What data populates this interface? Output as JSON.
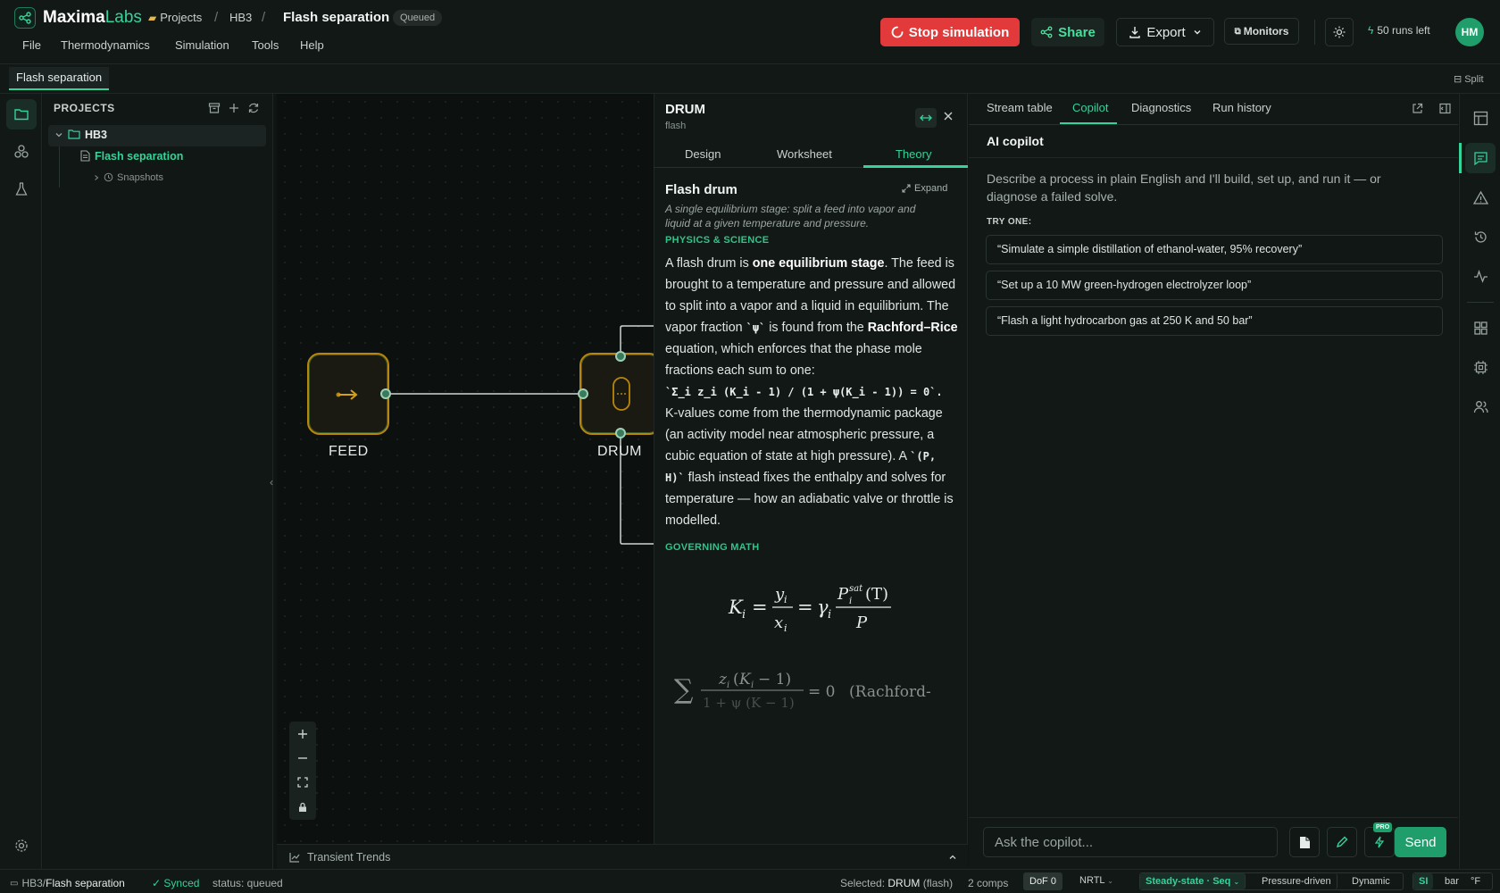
{
  "app": {
    "brand_main": "Maxima",
    "brand_accent": "Labs"
  },
  "breadcrumb": {
    "projects": "Projects",
    "project": "HB3",
    "title": "Flash separation",
    "status": "Queued"
  },
  "menus": [
    "File",
    "Thermodynamics",
    "Simulation",
    "Tools",
    "Help"
  ],
  "toolbar": {
    "stop": "Stop simulation",
    "share": "Share",
    "export": "Export",
    "monitors": "Monitors",
    "runs_left": "50 runs left",
    "avatar": "HM"
  },
  "doc_tab": "Flash separation",
  "split_label": "Split",
  "projects": {
    "title": "PROJECTS",
    "folder": "HB3",
    "file": "Flash separation",
    "snapshots": "Snapshots"
  },
  "canvas": {
    "nodes": [
      {
        "id": "feed",
        "label": "FEED"
      },
      {
        "id": "drum",
        "label": "DRUM"
      }
    ],
    "trends_label": "Transient Trends"
  },
  "drum_panel": {
    "title": "DRUM",
    "subtitle": "flash",
    "tabs": [
      "Design",
      "Worksheet",
      "Theory"
    ],
    "active_tab": "Theory",
    "heading": "Flash drum",
    "expand": "Expand",
    "description": "A single equilibrium stage: split a feed into vapor and liquid at a given temperature and pressure.",
    "section1": "PHYSICS & SCIENCE",
    "body": {
      "p1": "A flash drum is ",
      "p1_bold": "one equilibrium stage",
      "p2": ". The feed is brought to a temperature and pressure and allowed to split into a vapor and a liquid in equilibrium. The vapor fraction ",
      "p2_code": "`ψ`",
      "p3": " is found from the ",
      "p3_bold": "Rachford–Rice",
      "p4": " equation, which enforces that the phase mole fractions each sum to one:",
      "eq_code": "`Σ_i z_i (K_i - 1) / (1 + ψ(K_i - 1)) = 0`.",
      "p5": "K-values come from the thermodynamic package (an activity model near atmospheric pressure, a cubic equation of state at high pressure). A ",
      "p5_code": "`(P, H)`",
      "p6": " flash instead fixes the enthalpy and solves for temperature — how an adiabatic valve or throttle is modelled."
    },
    "section2": "GOVERNING MATH",
    "math_tag": "(Rachford-"
  },
  "right_panel": {
    "tabs": [
      "Stream table",
      "Copilot",
      "Diagnostics",
      "Run history"
    ],
    "active_tab": "Copilot",
    "title": "AI copilot",
    "intro": "Describe a process in plain English and I'll build, set up, and run it — or diagnose a failed solve.",
    "try_one": "TRY ONE:",
    "suggestions": [
      "“Simulate a simple distillation of ethanol-water, 95% recovery”",
      "“Set up a 10 MW green-hydrogen electrolyzer loop”",
      "“Flash a light hydrocarbon gas at 250 K and 50 bar”"
    ],
    "input_placeholder": "Ask the copilot...",
    "pro_badge": "PRO",
    "send": "Send"
  },
  "statusbar": {
    "path_project": "HB3",
    "path_sep": " / ",
    "path_file": "Flash separation",
    "synced": "✓ Synced",
    "status": "status: queued",
    "selected_prefix": "Selected: ",
    "selected_name": "DRUM",
    "selected_type": "(flash)",
    "comps": "2 comps",
    "dof": "DoF 0",
    "thermo": "NRTL",
    "mode": "Steady-state · Seq",
    "pressure": "Pressure-driven",
    "dynamic": "Dynamic",
    "unit_si": "SI",
    "unit_bar": "bar",
    "unit_f": "°F"
  },
  "colors": {
    "accent": "#34d399",
    "stop": "#e23a3a",
    "node_border": "#b8860b"
  }
}
